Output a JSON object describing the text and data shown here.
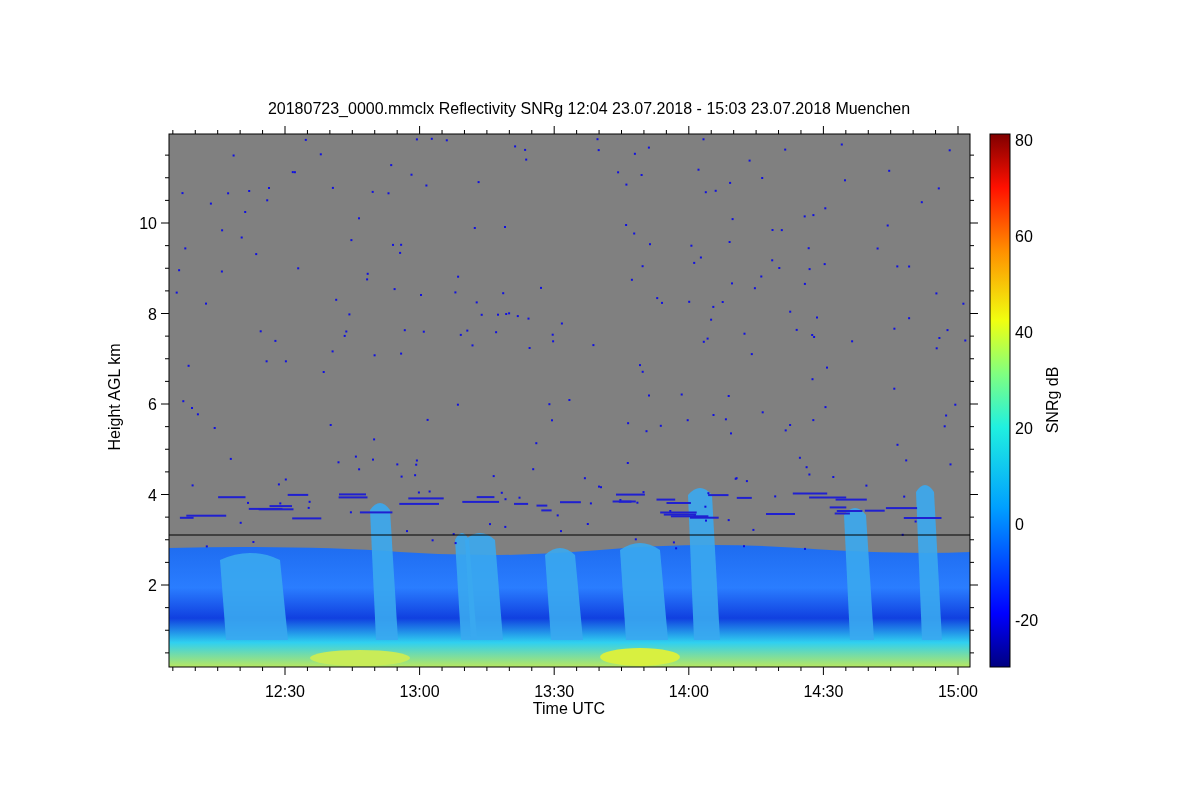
{
  "title": "20180723_0000.mmclx Reflectivity SNRg   12:04 23.07.2018 - 15:03 23.07.2018 Muenchen",
  "y_axis": {
    "label": "Height AGL km",
    "ticks": [
      "10",
      "8",
      "6",
      "4",
      "2"
    ]
  },
  "x_axis": {
    "label": "Time UTC",
    "ticks": [
      "12:30",
      "13:00",
      "13:30",
      "14:00",
      "14:30",
      "15:00"
    ]
  },
  "colorbar": {
    "label": "SNRg dB",
    "ticks": [
      "80",
      "60",
      "40",
      "20",
      "0",
      "-20"
    ]
  }
}
